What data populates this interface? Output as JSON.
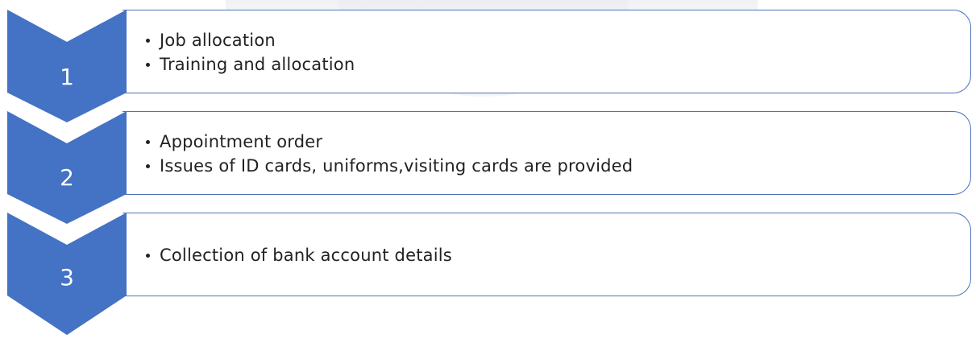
{
  "steps": [
    {
      "number": "1",
      "bullets": [
        "Job allocation",
        "Training and allocation"
      ]
    },
    {
      "number": "2",
      "bullets": [
        "Appointment order",
        "Issues of ID cards, uniforms,visiting cards are provided"
      ]
    },
    {
      "number": "3",
      "bullets": [
        "Collection of bank account details"
      ]
    }
  ],
  "colors": {
    "chevron": "#4472c4",
    "border": "#4f72b9",
    "text": "#222222"
  }
}
